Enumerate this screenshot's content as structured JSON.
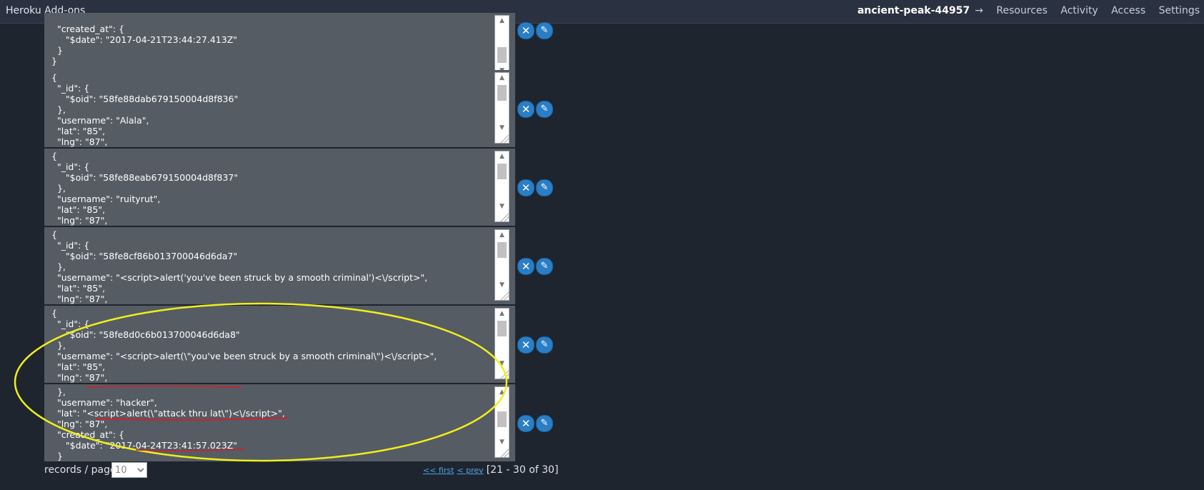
{
  "topbar": {
    "title": "Heroku Add-ons",
    "app_name": "ancient-peak-44957",
    "arrow": "→",
    "links": [
      "Resources",
      "Activity",
      "Access",
      "Settings"
    ]
  },
  "records": [
    {
      "text": "  \"created_at\": {\n     \"$date\": \"2017-04-21T23:44:27.413Z\"\n  }\n}"
    },
    {
      "text": "{\n  \"_id\": {\n     \"$oid\": \"58fe88dab679150004d8f836\"\n  },\n  \"username\": \"Alala\",\n  \"lat\": \"85\",\n  \"lng\": \"87\","
    },
    {
      "text": "{\n  \"_id\": {\n     \"$oid\": \"58fe88eab679150004d8f837\"\n  },\n  \"username\": \"ruityrut\",\n  \"lat\": \"85\",\n  \"lng\": \"87\","
    },
    {
      "text": "{\n  \"_id\": {\n     \"$oid\": \"58fe8cf86b013700046d6da7\"\n  },\n  \"username\": \"<script>alert('you've been struck by a smooth criminal')<\\/script>\",\n  \"lat\": \"85\",\n  \"lng\": \"87\","
    },
    {
      "text": "{\n  \"_id\": {\n     \"$oid\": \"58fe8d0c6b013700046d6da8\"\n  },\n  \"username\": \"<script>alert(\\\"you've been struck by a smooth criminal\\\")<\\/script>\",\n  \"lat\": \"85\",\n  \"lng\": \"87\","
    },
    {
      "text": "  },\n  \"username\": \"hacker\",\n  \"lat\": \"<script>alert(\\\"attack thru lat\\\")<\\/script>\",\n  \"lng\": \"87\",\n  \"created_at\": {\n     \"$date\": \"2017-04-24T23:41:57.023Z\"\n  }"
    }
  ],
  "icons": {
    "delete": "close-icon",
    "edit": "edit-icon"
  },
  "delete_glyph": "✕",
  "edit_glyph": "✎",
  "scroll_up_glyph": "▲",
  "scroll_down_glyph": "▼",
  "pager": {
    "label": "records / page",
    "per_page": "10",
    "first": "<< first",
    "prev": "< prev",
    "range": "[21 - 30 of 30]"
  },
  "colors": {
    "background": "#1e252e",
    "record_bg": "#555c64",
    "button": "#2a7ec6",
    "highlight_ellipse": "#f2ee1a",
    "underline": "#d0202a"
  }
}
